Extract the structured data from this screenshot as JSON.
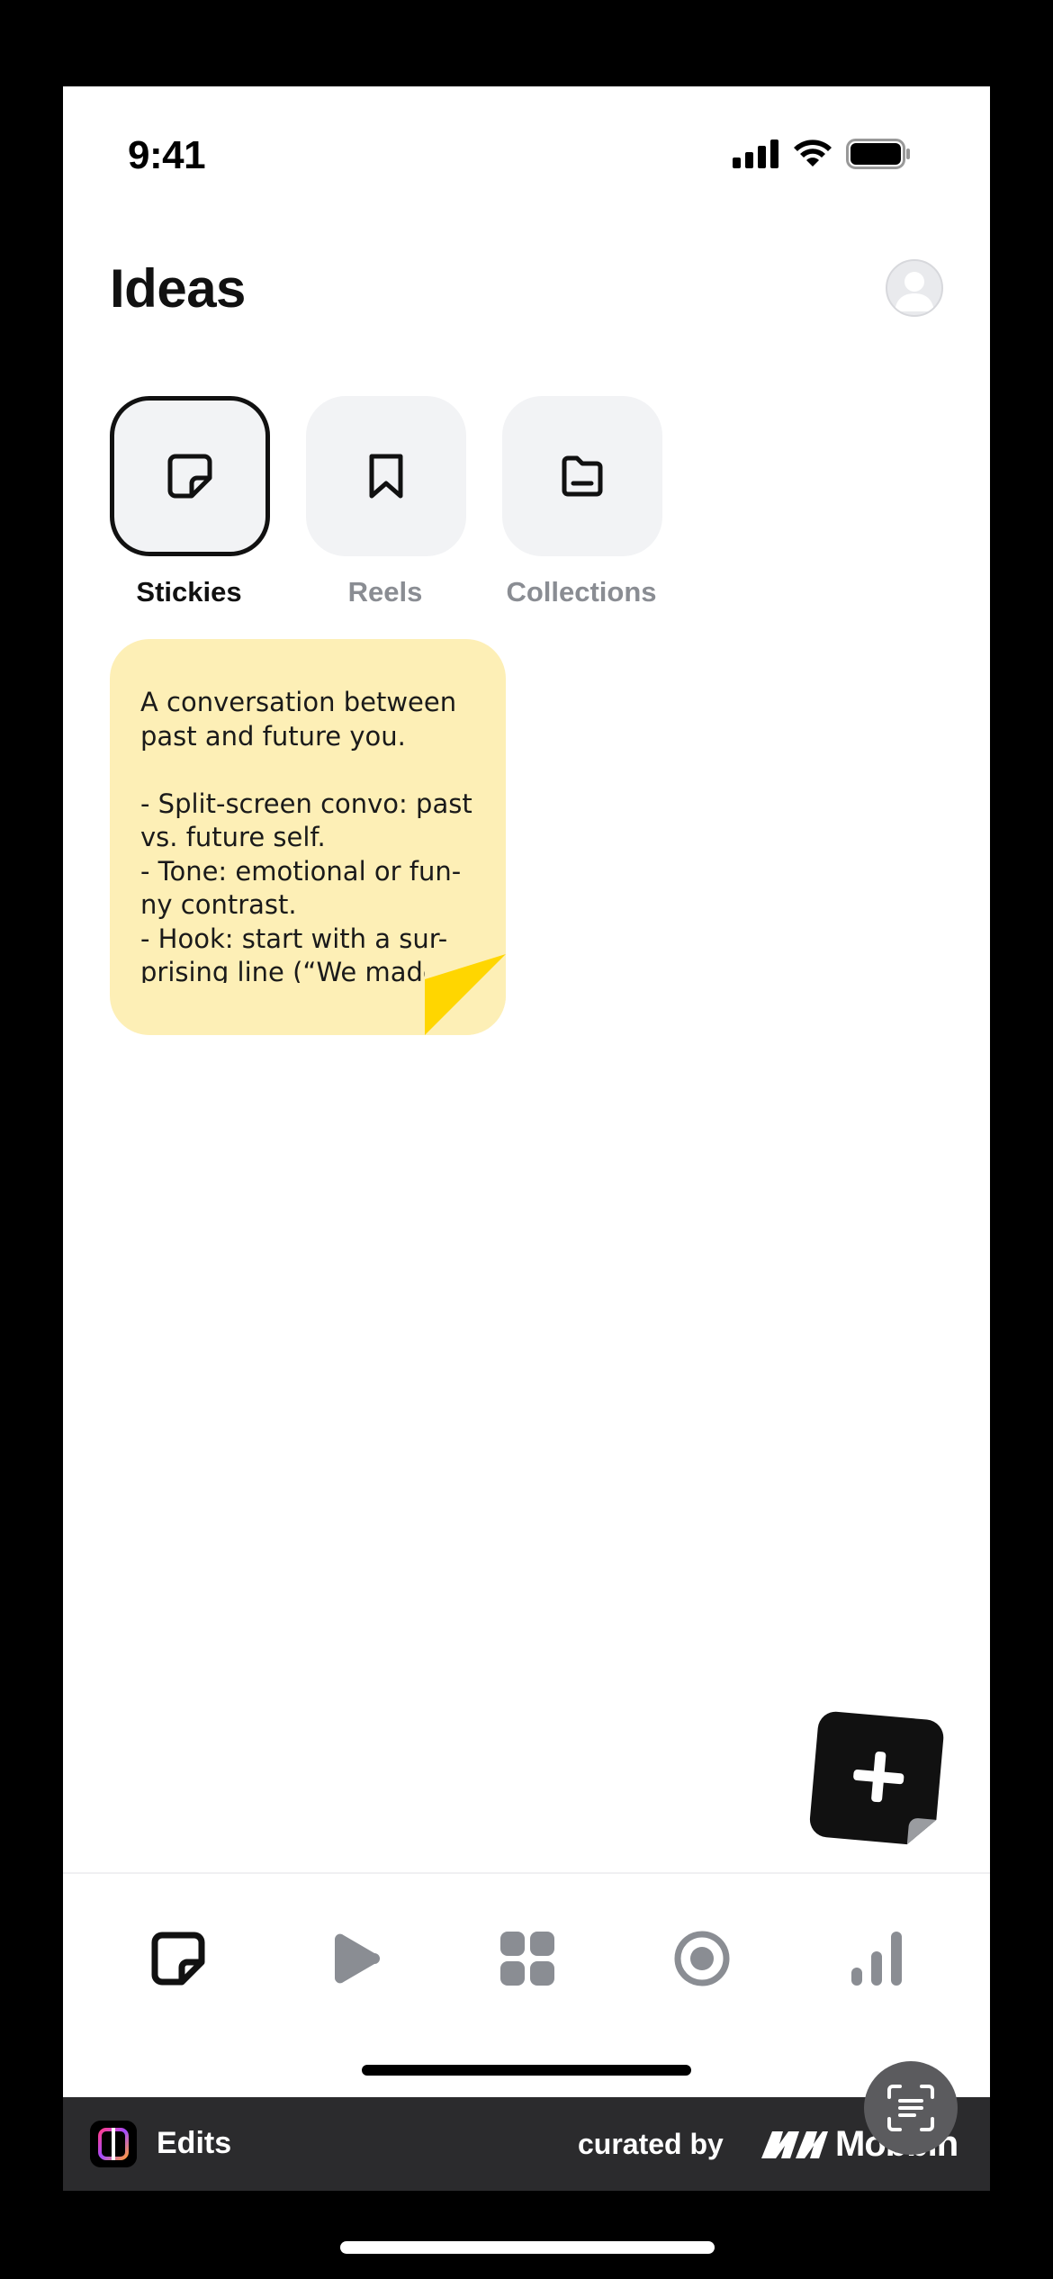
{
  "status_bar": {
    "time": "9:41"
  },
  "header": {
    "title": "Ideas"
  },
  "categories": [
    {
      "label": "Stickies",
      "icon": "sticky-note-icon",
      "active": true
    },
    {
      "label": "Reels",
      "icon": "bookmark-icon",
      "active": false
    },
    {
      "label": "Collections",
      "icon": "folder-icon",
      "active": false
    }
  ],
  "sticky": {
    "text": "A conversation between past and future you.\n\n- Split-screen convo: past vs. future self.\n- Tone: emotional or fun-ny contrast.\n- Hook: start with a sur-prising line (“We made",
    "background": "#fdefb6",
    "fold_color": "#ffd600"
  },
  "bottom_nav": [
    {
      "name": "ideas",
      "icon": "sticky-note-icon",
      "active": true
    },
    {
      "name": "play",
      "icon": "play-icon",
      "active": false
    },
    {
      "name": "grid",
      "icon": "grid-icon",
      "active": false
    },
    {
      "name": "record",
      "icon": "record-icon",
      "active": false
    },
    {
      "name": "insights",
      "icon": "bar-chart-icon",
      "active": false
    }
  ],
  "footer": {
    "app_name": "Edits",
    "curated_by": "curated by",
    "brand": "Mobbin"
  },
  "colors": {
    "accent": "#111111",
    "inactive": "#8a8d93",
    "tile_bg": "#f2f3f5"
  }
}
